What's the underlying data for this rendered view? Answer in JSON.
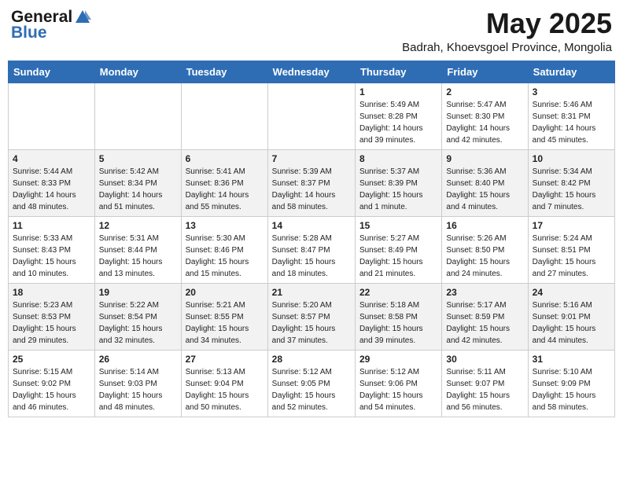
{
  "header": {
    "logo_general": "General",
    "logo_blue": "Blue",
    "title": "May 2025",
    "subtitle": "Badrah, Khoevsgoel Province, Mongolia"
  },
  "weekdays": [
    "Sunday",
    "Monday",
    "Tuesday",
    "Wednesday",
    "Thursday",
    "Friday",
    "Saturday"
  ],
  "weeks": [
    [
      {
        "day": "",
        "info": ""
      },
      {
        "day": "",
        "info": ""
      },
      {
        "day": "",
        "info": ""
      },
      {
        "day": "",
        "info": ""
      },
      {
        "day": "1",
        "info": "Sunrise: 5:49 AM\nSunset: 8:28 PM\nDaylight: 14 hours\nand 39 minutes."
      },
      {
        "day": "2",
        "info": "Sunrise: 5:47 AM\nSunset: 8:30 PM\nDaylight: 14 hours\nand 42 minutes."
      },
      {
        "day": "3",
        "info": "Sunrise: 5:46 AM\nSunset: 8:31 PM\nDaylight: 14 hours\nand 45 minutes."
      }
    ],
    [
      {
        "day": "4",
        "info": "Sunrise: 5:44 AM\nSunset: 8:33 PM\nDaylight: 14 hours\nand 48 minutes."
      },
      {
        "day": "5",
        "info": "Sunrise: 5:42 AM\nSunset: 8:34 PM\nDaylight: 14 hours\nand 51 minutes."
      },
      {
        "day": "6",
        "info": "Sunrise: 5:41 AM\nSunset: 8:36 PM\nDaylight: 14 hours\nand 55 minutes."
      },
      {
        "day": "7",
        "info": "Sunrise: 5:39 AM\nSunset: 8:37 PM\nDaylight: 14 hours\nand 58 minutes."
      },
      {
        "day": "8",
        "info": "Sunrise: 5:37 AM\nSunset: 8:39 PM\nDaylight: 15 hours\nand 1 minute."
      },
      {
        "day": "9",
        "info": "Sunrise: 5:36 AM\nSunset: 8:40 PM\nDaylight: 15 hours\nand 4 minutes."
      },
      {
        "day": "10",
        "info": "Sunrise: 5:34 AM\nSunset: 8:42 PM\nDaylight: 15 hours\nand 7 minutes."
      }
    ],
    [
      {
        "day": "11",
        "info": "Sunrise: 5:33 AM\nSunset: 8:43 PM\nDaylight: 15 hours\nand 10 minutes."
      },
      {
        "day": "12",
        "info": "Sunrise: 5:31 AM\nSunset: 8:44 PM\nDaylight: 15 hours\nand 13 minutes."
      },
      {
        "day": "13",
        "info": "Sunrise: 5:30 AM\nSunset: 8:46 PM\nDaylight: 15 hours\nand 15 minutes."
      },
      {
        "day": "14",
        "info": "Sunrise: 5:28 AM\nSunset: 8:47 PM\nDaylight: 15 hours\nand 18 minutes."
      },
      {
        "day": "15",
        "info": "Sunrise: 5:27 AM\nSunset: 8:49 PM\nDaylight: 15 hours\nand 21 minutes."
      },
      {
        "day": "16",
        "info": "Sunrise: 5:26 AM\nSunset: 8:50 PM\nDaylight: 15 hours\nand 24 minutes."
      },
      {
        "day": "17",
        "info": "Sunrise: 5:24 AM\nSunset: 8:51 PM\nDaylight: 15 hours\nand 27 minutes."
      }
    ],
    [
      {
        "day": "18",
        "info": "Sunrise: 5:23 AM\nSunset: 8:53 PM\nDaylight: 15 hours\nand 29 minutes."
      },
      {
        "day": "19",
        "info": "Sunrise: 5:22 AM\nSunset: 8:54 PM\nDaylight: 15 hours\nand 32 minutes."
      },
      {
        "day": "20",
        "info": "Sunrise: 5:21 AM\nSunset: 8:55 PM\nDaylight: 15 hours\nand 34 minutes."
      },
      {
        "day": "21",
        "info": "Sunrise: 5:20 AM\nSunset: 8:57 PM\nDaylight: 15 hours\nand 37 minutes."
      },
      {
        "day": "22",
        "info": "Sunrise: 5:18 AM\nSunset: 8:58 PM\nDaylight: 15 hours\nand 39 minutes."
      },
      {
        "day": "23",
        "info": "Sunrise: 5:17 AM\nSunset: 8:59 PM\nDaylight: 15 hours\nand 42 minutes."
      },
      {
        "day": "24",
        "info": "Sunrise: 5:16 AM\nSunset: 9:01 PM\nDaylight: 15 hours\nand 44 minutes."
      }
    ],
    [
      {
        "day": "25",
        "info": "Sunrise: 5:15 AM\nSunset: 9:02 PM\nDaylight: 15 hours\nand 46 minutes."
      },
      {
        "day": "26",
        "info": "Sunrise: 5:14 AM\nSunset: 9:03 PM\nDaylight: 15 hours\nand 48 minutes."
      },
      {
        "day": "27",
        "info": "Sunrise: 5:13 AM\nSunset: 9:04 PM\nDaylight: 15 hours\nand 50 minutes."
      },
      {
        "day": "28",
        "info": "Sunrise: 5:12 AM\nSunset: 9:05 PM\nDaylight: 15 hours\nand 52 minutes."
      },
      {
        "day": "29",
        "info": "Sunrise: 5:12 AM\nSunset: 9:06 PM\nDaylight: 15 hours\nand 54 minutes."
      },
      {
        "day": "30",
        "info": "Sunrise: 5:11 AM\nSunset: 9:07 PM\nDaylight: 15 hours\nand 56 minutes."
      },
      {
        "day": "31",
        "info": "Sunrise: 5:10 AM\nSunset: 9:09 PM\nDaylight: 15 hours\nand 58 minutes."
      }
    ]
  ]
}
